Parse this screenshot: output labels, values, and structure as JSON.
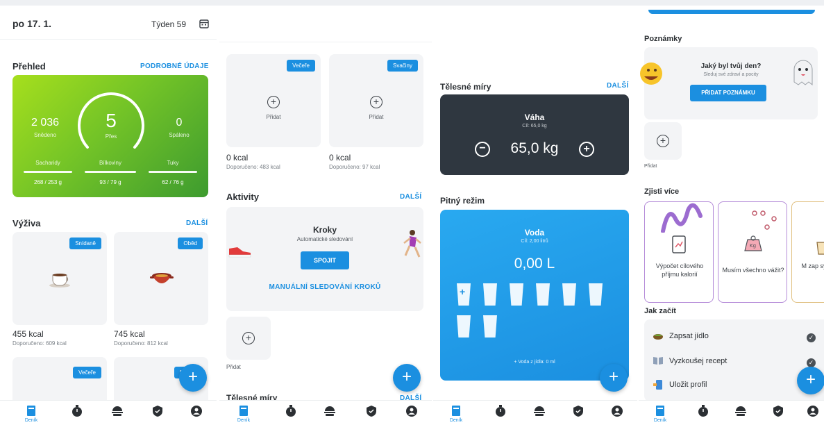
{
  "colors": {
    "accent": "#1b8fe0",
    "green_start": "#a6df1d",
    "green_end": "#3d9b2f",
    "dark_card": "#2f3740"
  },
  "header": {
    "date": "po 17. 1.",
    "week": "Týden 59",
    "calendar_icon": "calendar-icon"
  },
  "overview": {
    "title": "Přehled",
    "link": "PODROBNÉ ÚDAJE",
    "eaten_value": "2 036",
    "eaten_label": "Snědeno",
    "over_value": "5",
    "over_label": "Přes",
    "burned_value": "0",
    "burned_label": "Spáleno",
    "macros": [
      {
        "name": "Sacharidy",
        "value": "268 / 253 g"
      },
      {
        "name": "Bílkoviny",
        "value": "93 / 79 g"
      },
      {
        "name": "Tuky",
        "value": "62 / 76 g"
      }
    ]
  },
  "nutrition": {
    "title": "Výživa",
    "link": "DALŠÍ",
    "meals": [
      {
        "tag": "Snídaně",
        "kcal": "455 kcal",
        "recommended": "Doporučeno: 609 kcal",
        "icon": "coffee-cup-icon"
      },
      {
        "tag": "Oběd",
        "kcal": "745 kcal",
        "recommended": "Doporučeno: 812 kcal",
        "icon": "pot-icon"
      },
      {
        "tag": "Večeře"
      },
      {
        "tag": "S"
      }
    ]
  },
  "panel2": {
    "meals": [
      {
        "tag": "Večeře",
        "add": "Přidat",
        "kcal": "0 kcal",
        "recommended": "Doporučeno: 483 kcal"
      },
      {
        "tag": "Svačiny",
        "add": "Přidat",
        "kcal": "0 kcal",
        "recommended": "Doporučeno: 97 kcal"
      }
    ],
    "activities": {
      "title": "Aktivity",
      "link": "DALŠÍ",
      "card_title": "Kroky",
      "card_subtitle": "Automatické sledování",
      "connect": "SPOJIT",
      "manual": "MANUÁLNÍ SLEDOVÁNÍ KROKŮ",
      "add": "Přidat"
    },
    "body_title": "Tělesné míry",
    "body_link": "DALŠÍ"
  },
  "panel3": {
    "body_title": "Tělesné míry",
    "body_link": "DALŠÍ",
    "weight_title": "Váha",
    "weight_goal": "Cíl: 65,0 kg",
    "weight_value": "65,0 kg",
    "water_section": "Pitný režim",
    "water_title": "Voda",
    "water_goal": "Cíl: 2,00 litrů",
    "water_value": "0,00 L",
    "water_from_food": "+ Voda z jídla: 0 ml",
    "glasses_count": 8,
    "glasses_filled": 0
  },
  "panel4": {
    "notes_title": "Poznámky",
    "notes_question": "Jaký byl tvůj den?",
    "notes_sub": "Sleduj své zdraví a pocity",
    "notes_button": "PŘIDAT POZNÁMKU",
    "add": "Přidat",
    "learn_title": "Zjisti více",
    "cards": [
      {
        "text": "Výpočet cílového příjmu kalorií"
      },
      {
        "text": "Musím všechno vážit?"
      },
      {
        "text": "M zap syrov"
      }
    ],
    "start_title": "Jak začít",
    "todos": [
      {
        "label": "Zapsat jídlo",
        "icon": "food-icon"
      },
      {
        "label": "Vyzkoušej recept",
        "icon": "book-icon"
      },
      {
        "label": "Uložit profil",
        "icon": "profile-icon"
      }
    ]
  },
  "nav": {
    "diary_label": "Deník",
    "items": [
      "diary-icon",
      "timer-icon",
      "food-icon",
      "shield-icon",
      "profile-icon"
    ]
  },
  "fab_symbol": "+"
}
